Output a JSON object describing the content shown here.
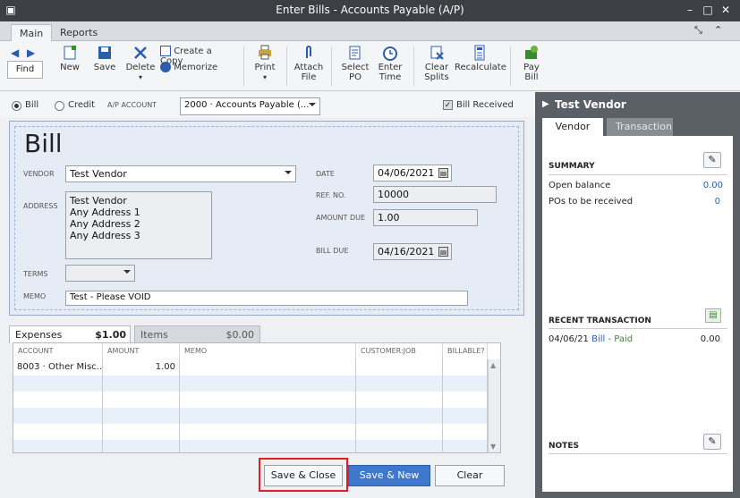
{
  "window": {
    "title": "Enter Bills - Accounts Payable (A/P)"
  },
  "ribbon_tabs": [
    "Main",
    "Reports"
  ],
  "toolbar": {
    "find": "Find",
    "new": "New",
    "save": "Save",
    "delete": "Delete",
    "create_copy": "Create a Copy",
    "memorize": "Memorize",
    "print": "Print",
    "attach_file": [
      "Attach",
      "File"
    ],
    "select_po": [
      "Select",
      "PO"
    ],
    "enter_time": [
      "Enter",
      "Time"
    ],
    "clear_splits": [
      "Clear",
      "Splits"
    ],
    "recalculate": "Recalculate",
    "pay_bill": [
      "Pay",
      "Bill"
    ]
  },
  "bill_type": {
    "bill_label": "Bill",
    "credit_label": "Credit",
    "ap_account_label": "A/P ACCOUNT",
    "ap_account_value": "2000 · Accounts Payable (...",
    "bill_received_label": "Bill Received"
  },
  "form": {
    "heading": "Bill",
    "vendor_label": "VENDOR",
    "vendor_value": "Test Vendor",
    "address_label": "ADDRESS",
    "address_lines": [
      "Test Vendor",
      "Any Address 1",
      "Any Address 2",
      "Any Address 3"
    ],
    "terms_label": "TERMS",
    "memo_label": "MEMO",
    "memo_value": "Test - Please VOID",
    "date_label": "DATE",
    "date_value": "04/06/2021",
    "ref_label": "REF. NO.",
    "ref_value": "10000",
    "amount_due_label": "AMOUNT DUE",
    "amount_due_value": "1.00",
    "bill_due_label": "BILL DUE",
    "bill_due_value": "04/16/2021"
  },
  "lines_tabs": {
    "expenses_label": "Expenses",
    "expenses_amount": "$1.00",
    "items_label": "Items",
    "items_amount": "$0.00"
  },
  "grid": {
    "headers": [
      "ACCOUNT",
      "AMOUNT",
      "MEMO",
      "CUSTOMER:JOB",
      "BILLABLE?"
    ],
    "rows": [
      {
        "account": "8003 · Other Misc...",
        "amount": "1.00",
        "memo": "",
        "customer": "",
        "billable": ""
      }
    ]
  },
  "buttons": {
    "save_close": "Save & Close",
    "save_new": "Save & New",
    "clear": "Clear"
  },
  "panel": {
    "vendor_name": "Test Vendor",
    "tabs": [
      "Vendor",
      "Transaction"
    ],
    "summary_title": "SUMMARY",
    "open_balance_label": "Open balance",
    "open_balance_value": "0.00",
    "pos_label": "POs to be received",
    "pos_value": "0",
    "recent_title": "RECENT TRANSACTION",
    "recent_date": "04/06/21",
    "recent_type": "Bill",
    "recent_status": "- Paid",
    "recent_amount": "0.00",
    "notes_title": "NOTES"
  },
  "colors": {
    "accent": "#3f77cc",
    "highlight": "#e02020",
    "form_bg": "#e6ecf6"
  }
}
